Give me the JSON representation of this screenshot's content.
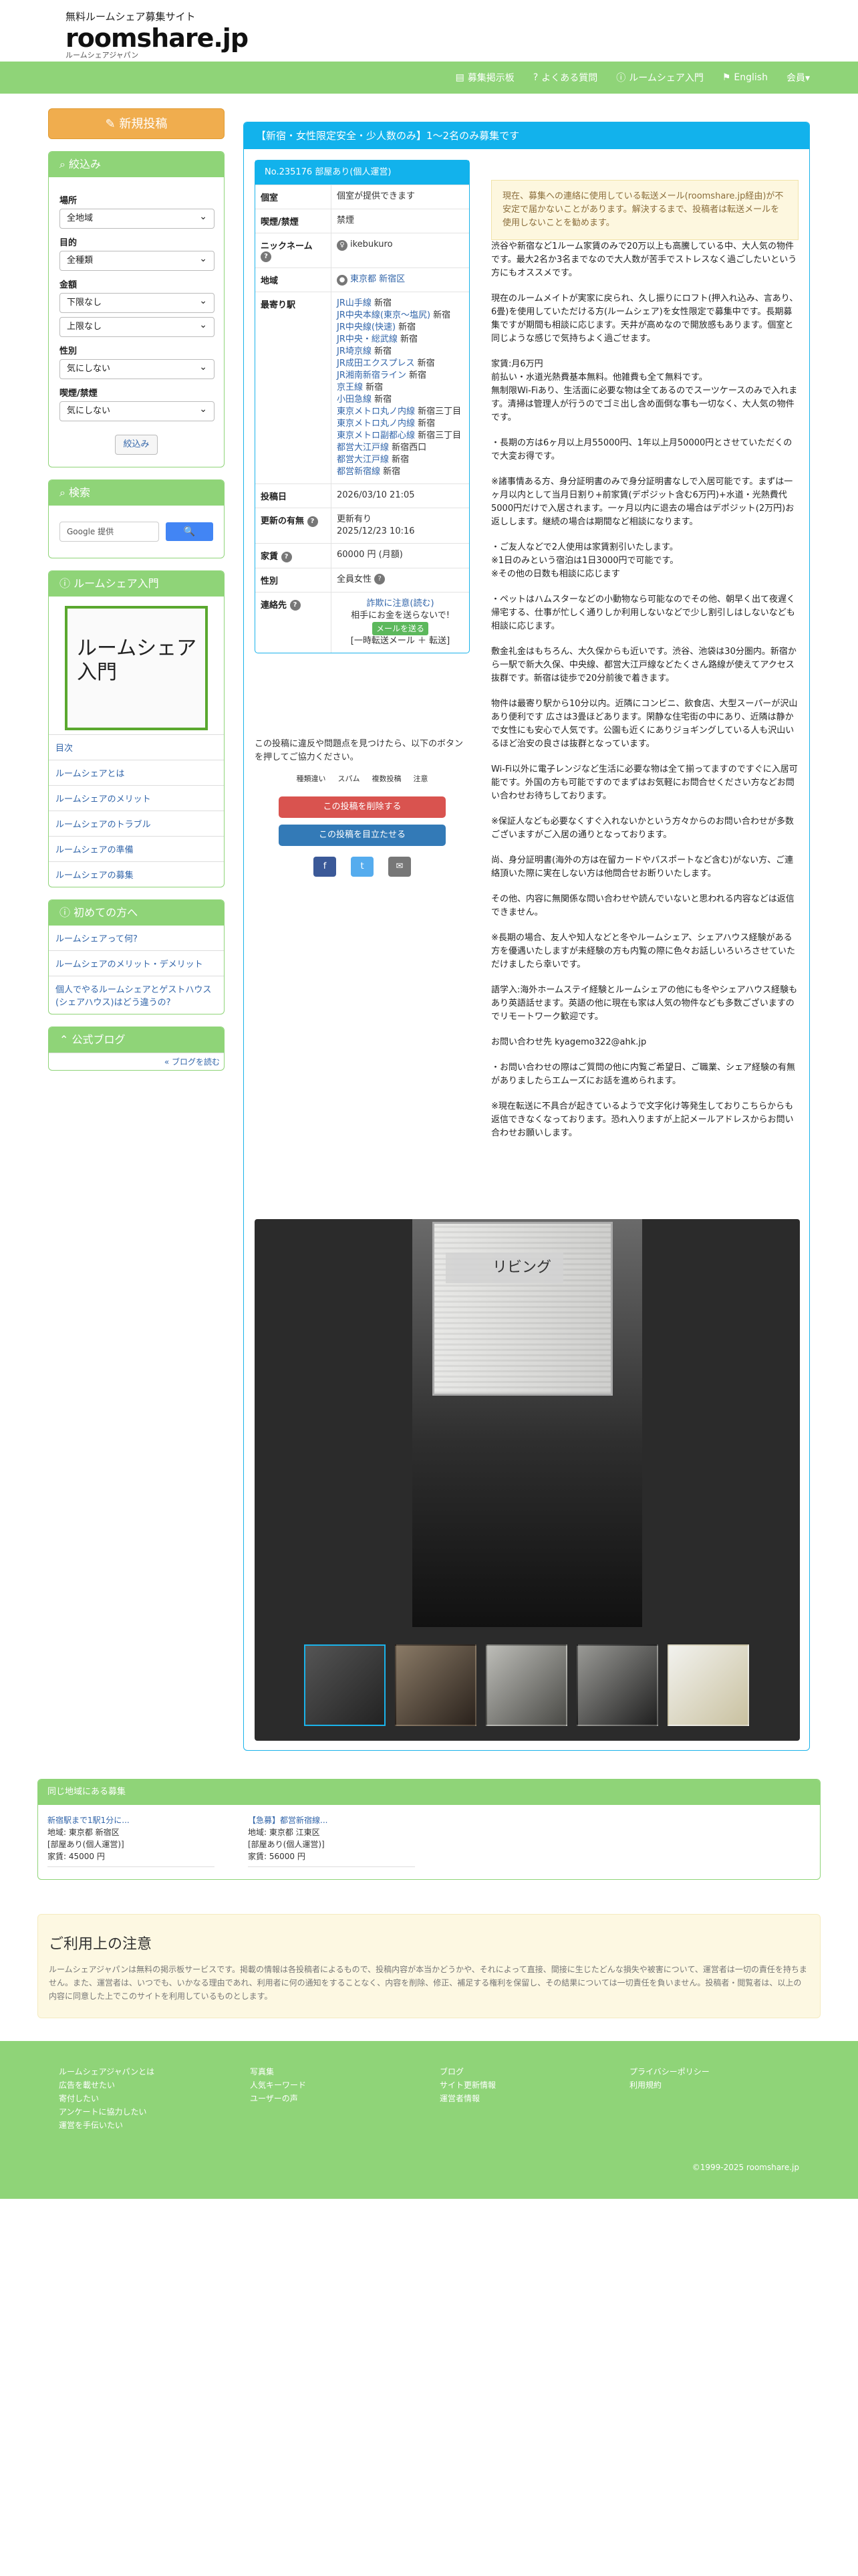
{
  "header": {
    "tagline": "無料ルームシェア募集サイト",
    "logo": "roomshare.jp",
    "logo_sub": "ルームシェアジャパン"
  },
  "nav": [
    "募集掲示板",
    "よくある質問",
    "ルームシェア入門",
    "English",
    "会員▾"
  ],
  "sidebar": {
    "new_post": "新規投稿",
    "filter": {
      "title": "絞込み",
      "fields": [
        {
          "label": "場所",
          "value": "全地域"
        },
        {
          "label": "目的",
          "value": "全種類"
        },
        {
          "label": "金額",
          "value": "下限なし",
          "value2": "上限なし"
        },
        {
          "label": "性別",
          "value": "気にしない"
        },
        {
          "label": "喫煙/禁煙",
          "value": "気にしない"
        }
      ],
      "submit": "絞込み"
    },
    "search": {
      "title": "検索",
      "placeholder": "Google 提供",
      "button": "🔍"
    },
    "intro": {
      "title": "ルームシェア入門",
      "image_text": "ルームシェア入門",
      "links": [
        "目次",
        "ルームシェアとは",
        "ルームシェアのメリット",
        "ルームシェアのトラブル",
        "ルームシェアの準備",
        "ルームシェアの募集"
      ]
    },
    "beginner": {
      "title": "初めての方へ",
      "links": [
        "ルームシェアって何?",
        "ルームシェアのメリット・デメリット",
        "個人でやるルームシェアとゲストハウス(シェアハウス)はどう違うの?"
      ]
    },
    "blog": {
      "title": "公式ブログ",
      "more": "« ブログを読む"
    }
  },
  "listing": {
    "title": "【新宿・女性限定安全・少人数のみ】1～2名のみ募集です",
    "info_header": "No.235176 部屋あり(個人運営)",
    "rows": [
      {
        "k": "個室",
        "v": "個室が提供できます"
      },
      {
        "k": "喫煙/禁煙",
        "v": "禁煙"
      },
      {
        "k": "ニックネーム",
        "v": "ikebukuro"
      },
      {
        "k": "地域",
        "v": "東京都 新宿区"
      },
      {
        "k": "投稿日",
        "v": "2026/03/10 21:05"
      },
      {
        "k": "更新の有無",
        "v": "更新有り",
        "v2": "2025/12/23 10:16"
      },
      {
        "k": "家賃",
        "v": "60000 円 (月額)"
      },
      {
        "k": "性別",
        "v": "全員女性"
      },
      {
        "k": "連絡先",
        "v": "詐欺に注意(読む)",
        "v2": "相手にお金を送らないで!",
        "v3": "メールを送る",
        "v4": "[一時転送メール ＋ 転送]"
      }
    ],
    "station_label": "最寄り駅",
    "stations": [
      {
        "line": "JR山手線",
        "st": "新宿"
      },
      {
        "line": "JR中央本線(東京～塩尻)",
        "st": "新宿"
      },
      {
        "line": "JR中央線(快速)",
        "st": "新宿"
      },
      {
        "line": "JR中央・総武線",
        "st": "新宿"
      },
      {
        "line": "JR埼京線",
        "st": "新宿"
      },
      {
        "line": "JR成田エクスプレス",
        "st": "新宿"
      },
      {
        "line": "JR湘南新宿ライン",
        "st": "新宿"
      },
      {
        "line": "京王線",
        "st": "新宿"
      },
      {
        "line": "小田急線",
        "st": "新宿"
      },
      {
        "line": "東京メトロ丸ノ内線",
        "st": "新宿三丁目"
      },
      {
        "line": "東京メトロ丸ノ内線",
        "st": "新宿"
      },
      {
        "line": "東京メトロ副都心線",
        "st": "新宿三丁目"
      },
      {
        "line": "都営大江戸線",
        "st": "新宿西口"
      },
      {
        "line": "都営大江戸線",
        "st": "新宿"
      },
      {
        "line": "都営新宿線",
        "st": "新宿"
      }
    ],
    "report": {
      "text": "この投稿に違反や問題点を見つけたら、以下のボタンを押してご協力ください。",
      "tags": [
        "種類違い",
        "スパム",
        "複数投稿",
        "注意"
      ],
      "btn_delete": "この投稿を削除する",
      "btn_top": "この投稿を目立たせる",
      "share": [
        "f",
        "t",
        "✉"
      ]
    },
    "notice": "現在、募集への連絡に使用している転送メール(roomshare.jp経由)が不安定で届かないことがあります。解決するまで、投稿者は転送メールを使用しないことを勧めます。",
    "desc": [
      "渋谷や新宿など1ルーム家賃のみで20万以上も高騰している中、大人気の物件です。最大2名か3名までなので大人数が苦手でストレスなく過ごしたいという方にもオススメです。",
      "現在のルームメイトが実家に戻られ、久し振りにロフト(押入れ込み、言あり、6畳)を使用していただける方(ルームシェア)を女性限定で募集中です。長期募集ですが期間も相談に応じます。天井が高めなので開放感もあります。個室と同じような感じで気持ちよく過ごせます。",
      "家賃:月6万円\n前払い・水道光熱費基本無料。他雑費も全て無料です。\n無制限Wi-Fiあり、生活面に必要な物は全てあるのでスーツケースのみで入れます。清掃は管理人が行うのでゴミ出し含め面倒な事も一切なく、大人気の物件です。",
      "・長期の方は6ヶ月以上月55000円、1年以上月50000円とさせていただくので大変お得です。",
      "※諸事情ある方、身分証明書のみで身分証明書なしで入居可能です。まずは一ヶ月以内として当月日割り+前家賃(デポジット含む6万円)+水道・光熱費代5000円だけで入居されます。一ヶ月以内に退去の場合はデポジット(2万円)お返しします。継続の場合は期間など相談になります。",
      "・ご友人などで2人使用は家賃割引いたします。\n※1日のみという宿泊は1日3000円で可能です。\n※その他の日数も相談に応じます",
      "・ペットはハムスターなどの小動物なら可能なのでその他、朝早く出て夜遅く帰宅する、仕事が忙しく通りしか利用しないなどで少し割引しはしないなども相談に応じます。",
      "敷金礼金はもちろん、大久保からも近いです。渋谷、池袋は30分圏内。新宿から一駅で新大久保、中央線、都営大江戸線などたくさん路線が使えてアクセス抜群です。新宿は徒歩で20分前後で着きます。",
      "物件は最寄り駅から10分以内。近隣にコンビニ、飲食店、大型スーパーが沢山あり便利です 広さは3畳ほどあります。閑静な住宅街の中にあり、近隣は静かで女性にも安心で人気です。公園も近くにありジョギングしている人も沢山いるほど治安の良さは抜群となっています。",
      "Wi-Fi以外に電子レンジなど生活に必要な物は全て揃ってますのですぐに入居可能です。外国の方も可能ですのでまずはお気軽にお問合せください方などお問い合わせお待ちしております。",
      "※保証人なども必要なくすぐ入れないかという方々からのお問い合わせが多数ございますがご入居の通りとなっております。",
      "尚、身分証明書(海外の方は在留カードやパスポートなど含む)がない方、ご連絡頂いた際に実在しない方は他問合せお断りいたします。",
      "その他、内容に無関係な問い合わせや読んでいないと思われる内容などは返信できません。",
      "※長期の場合、友人や知人などと冬やルームシェア、シェアハウス経験がある方を優遇いたしますが未経験の方も内覧の際に色々お話しいろいろさせていただけましたら幸いです。",
      "語学入:海外ホームステイ経験とルームシェアの他にも冬やシェアハウス経験もあり英語話せます。英語の他に現在も家は人気の物件なども多数ございますのでリモートワーク歓迎です。",
      "お問い合わせ先 kyagemo322@ahk.jp",
      "・お問い合わせの際はご質問の他に内覧ご希望日、ご職業、シェア経験の有無がありましたらエムーズにお話を進められます。",
      "※現在転送に不具合が起きているようで文字化け等発生しておりこちらからも返信できなくなっております。恐れ入りますが上記メールアドレスからお問い合わせお願いします。"
    ],
    "photo_label": "リビング"
  },
  "nearby": {
    "title": "同じ地域にある募集",
    "items": [
      {
        "title": "新宿駅まで1駅1分に...",
        "area": "地域: 東京都 新宿区",
        "type": "[部屋あり(個人運営)]",
        "rent": "家賃: 45000 円"
      },
      {
        "title": "【急募】都営新宿線...",
        "area": "地域: 東京都 江東区",
        "type": "[部屋あり(個人運営)]",
        "rent": "家賃: 56000 円"
      }
    ]
  },
  "caution": {
    "title": "ご利用上の注意",
    "text": "ルームシェアジャパンは無料の掲示板サービスです。掲載の情報は各投稿者によるもので、投稿内容が本当かどうかや、それによって直接、間接に生じたどんな損失や被害について、運営者は一切の責任を持ちません。また、運営者は、いつでも、いかなる理由であれ、利用者に何の通知をすることなく、内容を削除、修正、補足する権利を保留し、その結果については一切責任を負いません。投稿者・閲覧者は、以上の内容に同意した上でこのサイトを利用しているものとします。"
  },
  "footer": {
    "col1": [
      "ルームシェアジャパンとは",
      "広告を載せたい",
      "寄付したい",
      "アンケートに協力したい",
      "運営を手伝いたい"
    ],
    "col2": [
      "写真集",
      "人気キーワード",
      "ユーザーの声"
    ],
    "col3": [
      "ブログ",
      "サイト更新情報",
      "運営者情報"
    ],
    "col4": [
      "プライバシーポリシー",
      "利用規約"
    ],
    "copyright": "©1999-2025 roomshare.jp"
  }
}
